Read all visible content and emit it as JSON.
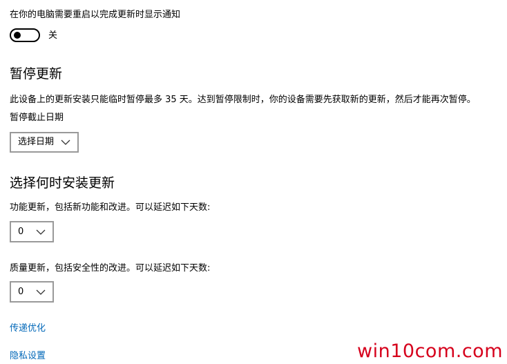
{
  "restart_notify": {
    "label": "在你的电脑需要重启以完成更新时显示通知",
    "toggle_state": "关",
    "toggle_on": false
  },
  "pause": {
    "heading": "暂停更新",
    "description": "此设备上的更新安装只能临时暂停最多 35 天。达到暂停限制时，你的设备需要先获取新的更新，然后才能再次暂停。",
    "date_label": "暂停截止日期",
    "date_dropdown": "选择日期"
  },
  "install_time": {
    "heading": "选择何时安装更新",
    "feature_label": "功能更新，包括新功能和改进。可以延迟如下天数:",
    "feature_value": "0",
    "quality_label": "质量更新，包括安全性的改进。可以延迟如下天数:",
    "quality_value": "0"
  },
  "links": {
    "delivery_optimization": "传递优化",
    "privacy_settings": "隐私设置"
  },
  "watermark": "win10com.com",
  "colors": {
    "link": "#0067b8",
    "watermark": "#d6001c",
    "dropdown_border": "#999999"
  }
}
